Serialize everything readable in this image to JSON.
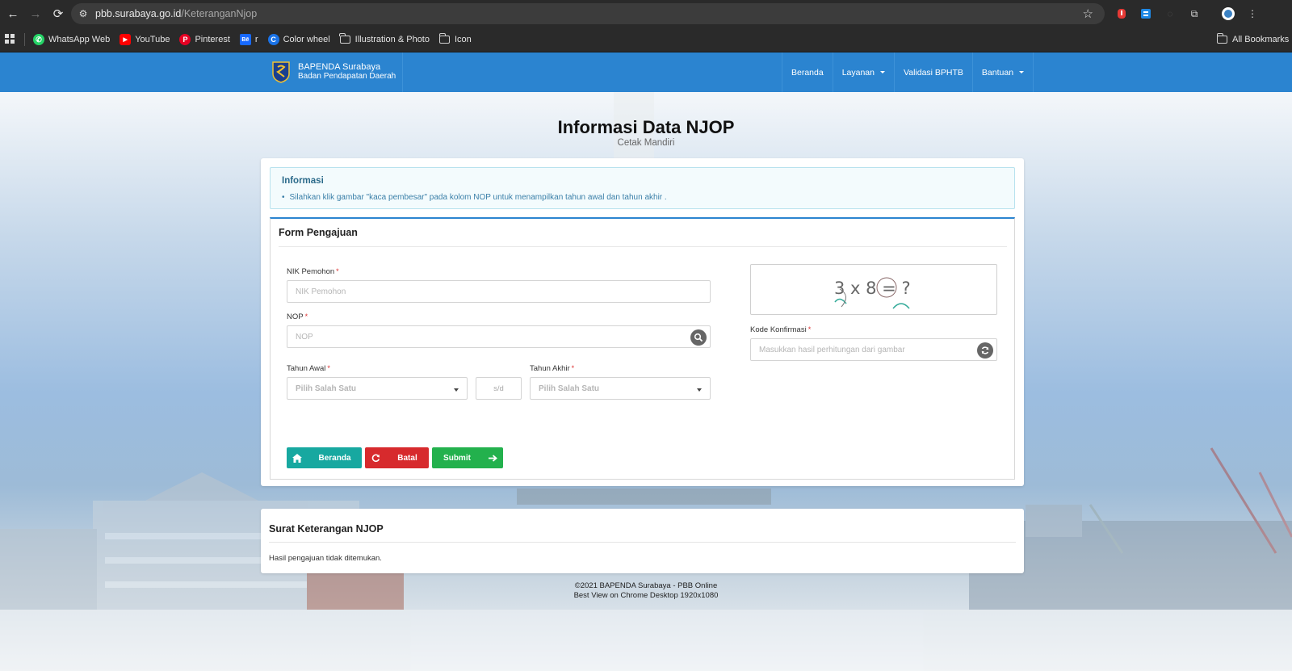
{
  "browser": {
    "url_host": "pbb.surabaya.go.id",
    "url_path": "/KeteranganNjop",
    "bookmarks": [
      {
        "label": "WhatsApp Web",
        "icon": "whatsapp-icon",
        "color": "#25d366"
      },
      {
        "label": "YouTube",
        "icon": "youtube-icon",
        "color": "#ff0000"
      },
      {
        "label": "Pinterest",
        "icon": "pinterest-icon",
        "color": "#e60023"
      },
      {
        "label": "r",
        "icon": "behance-icon",
        "color": "#1769ff"
      },
      {
        "label": "Color wheel",
        "icon": "color-wheel-icon",
        "color": "#1a73e8"
      },
      {
        "label": "Illustration & Photo",
        "icon": "folder-icon"
      },
      {
        "label": "Icon",
        "icon": "folder-icon"
      }
    ],
    "all_bookmarks": "All Bookmarks"
  },
  "appnav": {
    "brand_title": "BAPENDA Surabaya",
    "brand_subtitle": "Badan Pendapatan Daerah",
    "menu": [
      "Beranda",
      "Layanan",
      "Validasi BPHTB",
      "Bantuan"
    ]
  },
  "page": {
    "title": "Informasi Data NJOP",
    "subtitle": "Cetak Mandiri"
  },
  "info": {
    "heading": "Informasi",
    "item": "Silahkan klik gambar \"kaca pembesar\" pada kolom NOP untuk menampilkan tahun awal dan tahun akhir ."
  },
  "form": {
    "heading": "Form Pengajuan",
    "nik_label": "NIK Pemohon",
    "nik_placeholder": "NIK Pemohon",
    "nop_label": "NOP",
    "nop_placeholder": "NOP",
    "tahun_awal_label": "Tahun Awal",
    "tahun_awal_placeholder": "Pilih Salah Satu",
    "sd": "s/d",
    "tahun_akhir_label": "Tahun Akhir",
    "tahun_akhir_placeholder": "Pilih Salah Satu",
    "captcha_text": "3 x 8 = ?",
    "kode_label": "Kode Konfirmasi",
    "kode_placeholder": "Masukkan hasil perhitungan dari gambar",
    "required_mark": "*",
    "buttons": {
      "beranda": "Beranda",
      "batal": "Batal",
      "submit": "Submit"
    }
  },
  "result": {
    "heading": "Surat Keterangan NJOP",
    "message": "Hasil pengajuan tidak ditemukan."
  },
  "footer": {
    "line1": "©2021 BAPENDA Surabaya - PBB Online",
    "line2": "Best View on Chrome Desktop 1920x1080"
  },
  "colors": {
    "nav": "#2b84d0",
    "beranda_btn": "#17a8a0",
    "batal_btn": "#d72a2d",
    "submit_btn": "#23b14d"
  }
}
